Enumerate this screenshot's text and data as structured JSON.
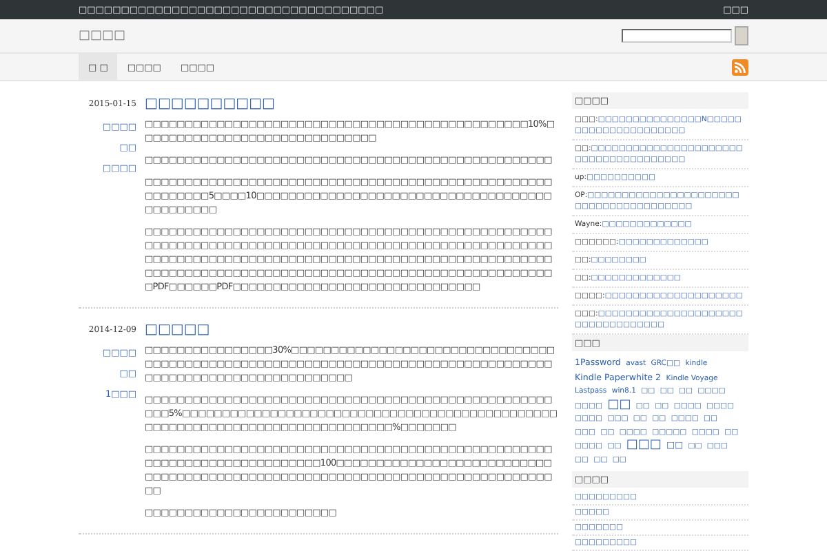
{
  "top_bar": {
    "tagline": "□□□□□□□□□□□□□□□□□□□□□□□□□□□□□□□□□□□□",
    "login": "□□□"
  },
  "header": {
    "site_name": "□□□□"
  },
  "nav": [
    {
      "label": "□ □",
      "selected": true
    },
    {
      "label": "□□□□",
      "selected": false
    },
    {
      "label": "□□□□",
      "selected": false
    }
  ],
  "posts": [
    {
      "date": "2015-01-15",
      "title": "□□□□□□□□□□",
      "meta": [
        "□□□□",
        "□□",
        "□□□□"
      ],
      "paragraphs": [
        "□□□□□□□□□□□□□□□□□□□□□□□□□□□□□□□□□□□□□□□□□□□□□□□□10%□□□□□□□□□□□□□□□□□□□□□□□□□□□□□□",
        "□□□□□□□□□□□□□□□□□□□□□□□□□□□□□□□□□□□□□□□□□□□□□□□□□□□",
        "□□□□□□□□□□□□□□□□□□□□□□□□□□□□□□□□□□□□□□□□□□□□□□□□□□□□□□□□□□□5□□□□10□□□□□□□□□□□□□□□□□□□□□□□□□□□□□□□□□□□□□□□□□□□□□□",
        "□□□□□□□□□□□□□□□□□□□□□□□□□□□□□□□□□□□□□□□□□□□□□□□□□□□□□□□□□□□□□□□□□□□□□□□□□□□□□□□□□□□□□□□□□□□□□□□□□□□□□□□□□□□□□□□□□□□□□□□□□□□□□□□□□□□□□□□□□□□□□□□□□□□□□□□□□□□□□□□□□□□□□□□□□□□□□□□□□□□□□□□□□□□□□□□□□□□□□□□□□□□□□PDF□□□□□□PDF□□□□□□□□□□□□□□□□□□□□□□□□□□□□□□□"
      ]
    },
    {
      "date": "2014-12-09",
      "title": "□□□□□",
      "meta": [
        "□□□□",
        "□□",
        "1□□□"
      ],
      "paragraphs": [
        "□□□□□□□□□□□□□□□□30%□□□□□□□□□□□□□□□□□□□□□□□□□□□□□□□□□□□□□□□□□□□□□□□□□□□□□□□□□□□□□□□□□□□□□□□□□□□□□□□□□□□□□□□□□□□□□□□□□□□□□□□□□□□□□□",
        "□□□□□□□□□□□□□□□□□□□□□□□□□□□□□□□□□□□□□□□□□□□□□□□□□□□□□□5%□□□□□□□□□□□□□□□□□□□□□□□□□□□□□□□□□□□□□□□□□□□□□□□□□□□□□□□□□□□□□□□□□□□□□□□□□□□□□□%□□□□□□□",
        "□□□□□□□□□□□□□□□□□□□□□□□□□□□□□□□□□□□□□□□□□□□□□□□□□□□□□□□□□□□□□□□□□□□□□□□□□100□□□□□□□□□□□□□□□□□□□□□□□□□□□□□□□□□□□□□□□□□□□□□□□□□□□□□□□□□□□□□□□□□□□□□□□□□□□□□□□□",
        "□□□□□□□□□□□□□□□□□□□□□□□□"
      ]
    }
  ],
  "sidebar": {
    "comments": {
      "title": "□□□□",
      "items": [
        {
          "author": "□□□:",
          "text": "□□□□□□□□□□□□□□□N□□□□□□□□□□□□□□□□□□□□□"
        },
        {
          "author": "□□:",
          "text": "□□□□□□□□□□□□□□□□□□□□□□□□□□□□□□□□□□□□□□"
        },
        {
          "author": "up:",
          "text": "□□□□□□□□□□"
        },
        {
          "author": "OP:",
          "text": "□□□□□□□□□□□□□□□□□□□□□□□□□□□□□□□□□□□□□□□"
        },
        {
          "author": "Wayne:",
          "text": "□□□□□□□□□□□□□"
        },
        {
          "author": "□□□□□□:",
          "text": "□□□□□□□□□□□□□"
        },
        {
          "author": "□□:",
          "text": "□□□□□□□□"
        },
        {
          "author": "□□:",
          "text": "□□□□□□□□□□□□□"
        },
        {
          "author": "□□□□:",
          "text": "□□□□□□□□□□□□□□□□□□□□"
        },
        {
          "author": "□□□:",
          "text": "□□□□□□□□□□□□□□□□□□□□□□□□□□□□□□□□□□"
        }
      ]
    },
    "tags": {
      "title": "□□□",
      "items": [
        {
          "label": "1Password",
          "kind": "medium"
        },
        {
          "label": "avast",
          "kind": "small"
        },
        {
          "label": "GRC□□",
          "kind": "small"
        },
        {
          "label": "kindle",
          "kind": "small"
        },
        {
          "label": "Kindle Paperwhite 2",
          "kind": "medium"
        },
        {
          "label": "Kindle Voyage",
          "kind": "small"
        },
        {
          "label": "Lastpass",
          "kind": "small"
        },
        {
          "label": "win8.1",
          "kind": "small"
        },
        {
          "label": "□□",
          "kind": "small"
        },
        {
          "label": "□□",
          "kind": "small"
        },
        {
          "label": "□□",
          "kind": "small"
        },
        {
          "label": "□□□□",
          "kind": "small"
        },
        {
          "label": "□□□□",
          "kind": "small"
        },
        {
          "label": "□□",
          "kind": "large"
        },
        {
          "label": "□□",
          "kind": "small"
        },
        {
          "label": "□□",
          "kind": "small"
        },
        {
          "label": "□□□□",
          "kind": "small"
        },
        {
          "label": "□□□□",
          "kind": "small"
        },
        {
          "label": "□□□□",
          "kind": "small"
        },
        {
          "label": "□□□",
          "kind": "small"
        },
        {
          "label": "□□",
          "kind": "small"
        },
        {
          "label": "□□",
          "kind": "small"
        },
        {
          "label": "□□□□",
          "kind": "small"
        },
        {
          "label": "□□",
          "kind": "small"
        },
        {
          "label": "□□□",
          "kind": "small"
        },
        {
          "label": "□□",
          "kind": "small"
        },
        {
          "label": "□□□□",
          "kind": "small"
        },
        {
          "label": "□□□□□",
          "kind": "small"
        },
        {
          "label": "□□□□",
          "kind": "small"
        },
        {
          "label": "□□",
          "kind": "small"
        },
        {
          "label": "□□□□",
          "kind": "small"
        },
        {
          "label": "□□",
          "kind": "small"
        },
        {
          "label": "□□□",
          "kind": "large"
        },
        {
          "label": "□□",
          "kind": "medium"
        },
        {
          "label": "□□",
          "kind": "small"
        },
        {
          "label": "□□□",
          "kind": "small"
        },
        {
          "label": "□□",
          "kind": "small"
        },
        {
          "label": "□□",
          "kind": "small"
        },
        {
          "label": "□□",
          "kind": "small"
        }
      ]
    },
    "links": {
      "title": "□□□□",
      "items": [
        "□□□□□□□□□",
        "□□□□□",
        "□□□□□□□",
        "□□□□□□□□□"
      ]
    }
  }
}
